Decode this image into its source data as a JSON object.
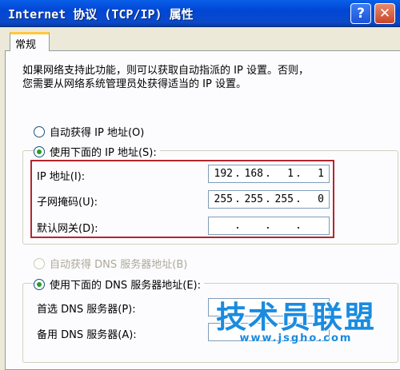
{
  "window": {
    "title": "Internet 协议 (TCP/IP) 属性",
    "help_label": "?",
    "close_label": "✕"
  },
  "tabs": [
    {
      "label": "常规"
    }
  ],
  "description": [
    "如果网络支持此功能，则可以获取自动指派的 IP 设置。否则，",
    "您需要从网络系统管理员处获得适当的 IP 设置。"
  ],
  "ip_section": {
    "auto_label": "自动获得 IP 地址(O)",
    "manual_label": "使用下面的 IP 地址(S):",
    "ip_label": "IP 地址(I):",
    "ip_value": [
      "192",
      "168",
      "1",
      "1"
    ],
    "mask_label": "子网掩码(U):",
    "mask_value": [
      "255",
      "255",
      "255",
      "0"
    ],
    "gateway_label": "默认网关(D):",
    "gateway_value": [
      "",
      "",
      "",
      ""
    ]
  },
  "dns_section": {
    "auto_label": "自动获得 DNS 服务器地址(B)",
    "manual_label": "使用下面的 DNS 服务器地址(E):",
    "preferred_label": "首选 DNS 服务器(P):",
    "alternate_label": "备用 DNS 服务器(A):"
  },
  "watermark": {
    "main": "技术员联盟",
    "url": "www.jsgho.com"
  },
  "colors": {
    "titlebar": "#0046D5",
    "highlight_border": "#B3262D",
    "watermark": "#1A8BE0"
  }
}
